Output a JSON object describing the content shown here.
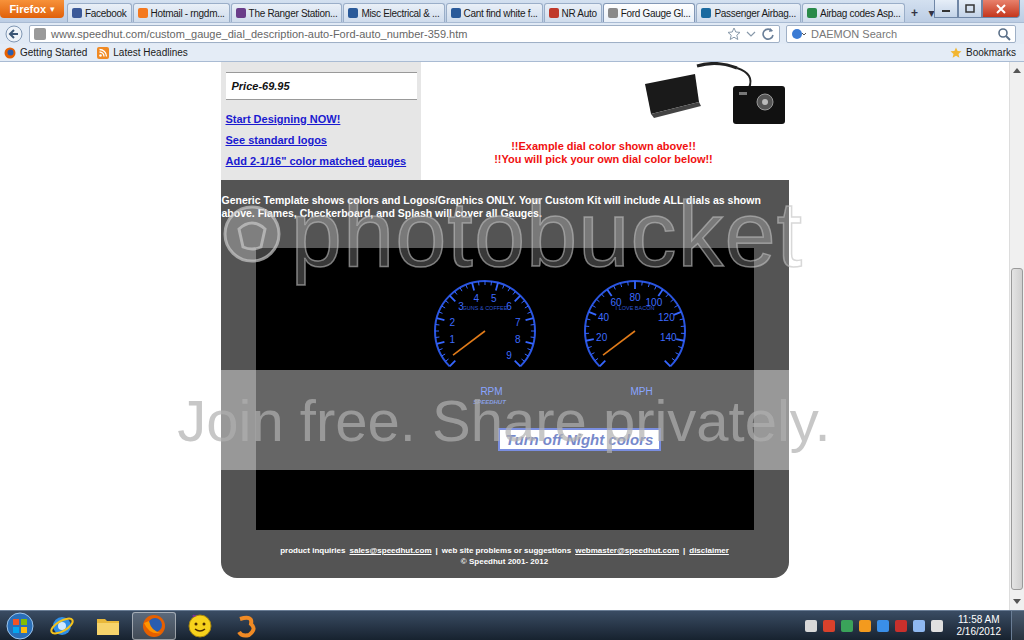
{
  "browser": {
    "menu_button": "Firefox",
    "menu_arrow": "▾",
    "tabs": [
      {
        "label": "Facebook",
        "selected": false,
        "color": "#3b5998"
      },
      {
        "label": "Hotmail - rngdm...",
        "selected": false,
        "color": "#f47920"
      },
      {
        "label": "The Ranger Station...",
        "selected": false,
        "color": "#6a3d8a"
      },
      {
        "label": "Misc Electrical & ...",
        "selected": false,
        "color": "#2a5a9a"
      },
      {
        "label": "Cant find white f...",
        "selected": false,
        "color": "#2a5a9a"
      },
      {
        "label": "NR Auto",
        "selected": false,
        "color": "#c0392b"
      },
      {
        "label": "Ford Gauge Gl...",
        "selected": true,
        "color": "#8a8a8a"
      },
      {
        "label": "Passenger Airbag...",
        "selected": false,
        "color": "#1a6aa0"
      },
      {
        "label": "Airbag codes Asp...",
        "selected": false,
        "color": "#2a8a4a"
      }
    ],
    "new_tab": "+",
    "tab_list": "▾",
    "url": "www.speedhut.com/custom_gauge_dial_description-auto-Ford-auto_number-359.htm",
    "search_placeholder": "DAEMON Search",
    "bookmarks": [
      "Getting Started",
      "Latest Headlines"
    ],
    "bookmarks_menu": "Bookmarks"
  },
  "page": {
    "price": "Price-69.95",
    "links": [
      "Start Designing NOW!",
      "See standard logos",
      "Add 2-1/16\" color matched gauges"
    ],
    "notes": [
      "!!Example dial color shown above!!",
      "!!You will pick your own dial color below!!"
    ],
    "template_note": "Generic Template shows colors and Logos/Graphics ONLY. Your Custom Kit will include ALL dials as shown above. Flames, Checkerboard, and Splash will cover all Gauges.",
    "gauges": [
      {
        "unit": "RPM",
        "caption": "GUNS & COFFEE",
        "ticks": [
          "1",
          "2",
          "3",
          "4",
          "5",
          "6",
          "7",
          "8",
          "9"
        ],
        "scale_max": 9,
        "level": 0.03
      },
      {
        "unit": "MPH",
        "caption": "I LOVE BACON",
        "ticks": [
          "20",
          "40",
          "60",
          "80",
          "100",
          "120",
          "140"
        ],
        "scale_max": 160,
        "level": 0.03
      }
    ],
    "dial_logo": "SPEEDHUT",
    "toggle_button": "Turn off Night colors",
    "footer": [
      {
        "text": "product inquiries",
        "link": false
      },
      {
        "text": "sales@speedhut.com",
        "link": true
      },
      {
        "text": "|",
        "link": false
      },
      {
        "text": "web site problems or suggestions",
        "link": false
      },
      {
        "text": "webmaster@speedhut.com",
        "link": true
      },
      {
        "text": "|",
        "link": false
      },
      {
        "text": "disclaimer",
        "link": true
      }
    ],
    "copyright": "© Speedhut 2001- 2012"
  },
  "watermark": {
    "brand": "photobucket",
    "slogan": "Join free. Share privately."
  },
  "taskbar": {
    "apps": [
      {
        "kind": "ie",
        "active": false
      },
      {
        "kind": "explorer",
        "active": false
      },
      {
        "kind": "firefox",
        "active": true
      },
      {
        "kind": "yahoo",
        "active": false
      },
      {
        "kind": "other",
        "active": false
      }
    ],
    "clock": {
      "time": "11:58 AM",
      "date": "2/16/2012"
    }
  }
}
